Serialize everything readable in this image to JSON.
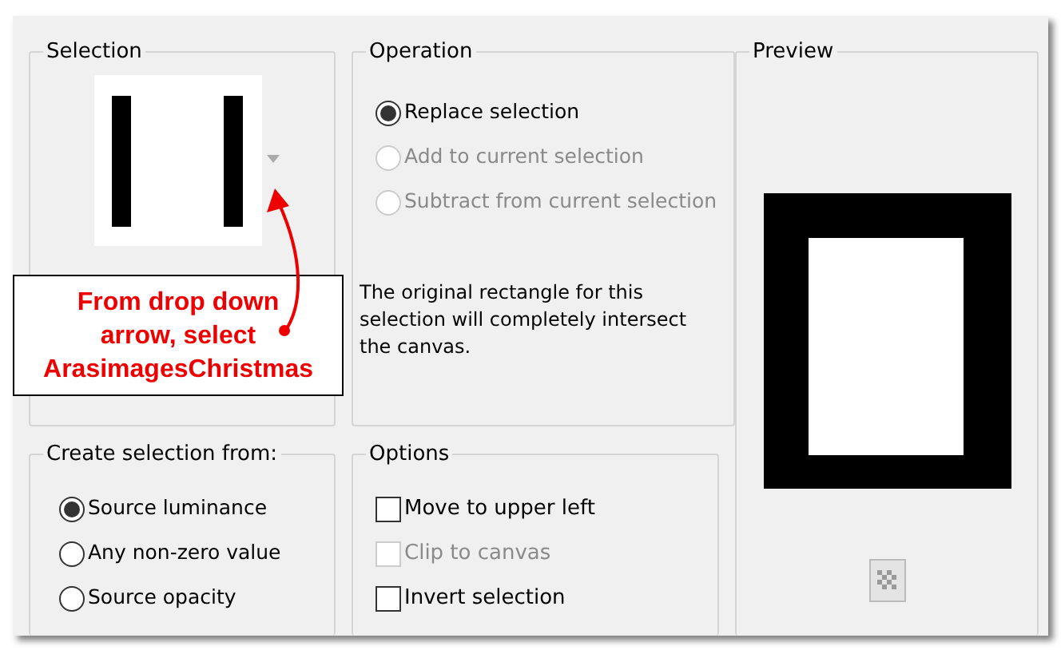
{
  "selection": {
    "title": "Selection"
  },
  "operation": {
    "title": "Operation",
    "options": [
      {
        "label": "Replace selection",
        "selected": true,
        "disabled": false
      },
      {
        "label": "Add to current selection",
        "selected": false,
        "disabled": true
      },
      {
        "label": "Subtract from current selection",
        "selected": false,
        "disabled": true
      }
    ],
    "note": "The original rectangle for this selection will completely intersect the canvas."
  },
  "preview": {
    "title": "Preview"
  },
  "create_from": {
    "title": "Create selection from:",
    "options": [
      {
        "label": "Source luminance",
        "selected": true
      },
      {
        "label": "Any non-zero value",
        "selected": false
      },
      {
        "label": "Source opacity",
        "selected": false
      }
    ]
  },
  "options": {
    "title": "Options",
    "items": [
      {
        "label": "Move to upper left",
        "checked": false,
        "disabled": false
      },
      {
        "label": "Clip to canvas",
        "checked": false,
        "disabled": true
      },
      {
        "label": "Invert selection",
        "checked": false,
        "disabled": false
      }
    ]
  },
  "callout": {
    "lines": [
      "From drop down",
      "arrow, select",
      "ArasimagesChristmas"
    ]
  }
}
